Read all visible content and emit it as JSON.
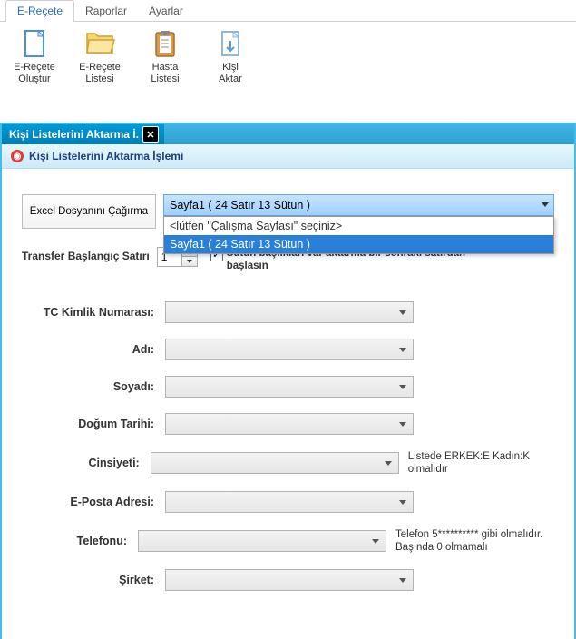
{
  "menu": {
    "tabs": [
      "E-Reçete",
      "Raporlar",
      "Ayarlar"
    ],
    "active": 0
  },
  "ribbon": {
    "items": [
      {
        "label": "E-Reçete\nOluştur",
        "icon": "new-doc-icon"
      },
      {
        "label": "E-Reçete\nListesi",
        "icon": "folder-icon"
      },
      {
        "label": "Hasta\nListesi",
        "icon": "clipboard-icon"
      },
      {
        "label": "Kişi\nAktar",
        "icon": "import-doc-icon"
      }
    ]
  },
  "innerWindow": {
    "tabTitle": "Kişi Listelerini Aktarma İ.",
    "subheader": "Kişi Listelerini Aktarma İşlemi"
  },
  "sheet": {
    "callButton": "Excel Dosyanını Çağırma",
    "selected": "Sayfa1 ( 24 Satır 13 Sütun )",
    "options": [
      "<lütfen \"Çalışma Sayfası\" seçiniz>",
      "Sayfa1 ( 24 Satır 13 Sütun )"
    ],
    "highlighted": 1
  },
  "transfer": {
    "label": "Transfer Başlangıç Satırı",
    "value": "1",
    "checkboxChecked": true,
    "checkboxLabel": "Sutun başlıkları var aktarma bir sonraki satırdan başlasın"
  },
  "fields": [
    {
      "label": "TC Kimlik Numarası:",
      "value": "",
      "hint": ""
    },
    {
      "label": "Adı:",
      "value": "",
      "hint": ""
    },
    {
      "label": "Soyadı:",
      "value": "",
      "hint": ""
    },
    {
      "label": "Doğum Tarihi:",
      "value": "",
      "hint": ""
    },
    {
      "label": "Cinsiyeti:",
      "value": "",
      "hint": "Listede ERKEK:E Kadın:K olmalıdır"
    },
    {
      "label": "E-Posta Adresi:",
      "value": "",
      "hint": ""
    },
    {
      "label": "Telefonu:",
      "value": "",
      "hint": "Telefon 5********** gibi olmalıdır. Başında 0 olmamalı"
    },
    {
      "label": "Şirket:",
      "value": "",
      "hint": ""
    }
  ]
}
